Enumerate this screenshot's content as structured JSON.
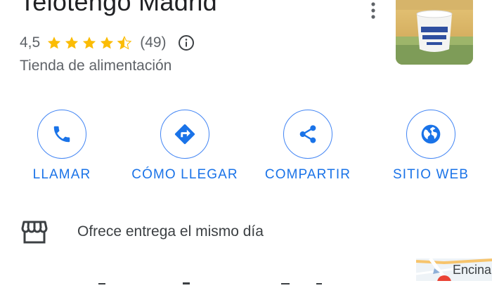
{
  "place": {
    "name": "Telotengo Madrid",
    "rating": "4,5",
    "stars_filled": 4.5,
    "review_count": "(49)",
    "category": "Tienda de alimentación"
  },
  "actions": [
    {
      "id": "call",
      "label": "LLAMAR",
      "icon": "phone-icon"
    },
    {
      "id": "directions",
      "label": "CÓMO LLEGAR",
      "icon": "directions-icon"
    },
    {
      "id": "share",
      "label": "COMPARTIR",
      "icon": "share-icon"
    },
    {
      "id": "website",
      "label": "SITIO WEB",
      "icon": "globe-icon"
    }
  ],
  "details": {
    "delivery": {
      "icon": "storefront-icon",
      "text": "Ofrece entrega el mismo día"
    }
  },
  "minimap": {
    "label": "Encinar"
  },
  "colors": {
    "accent": "#1a73e8",
    "star": "#fbbc04",
    "secondary_text": "#5f6368"
  }
}
